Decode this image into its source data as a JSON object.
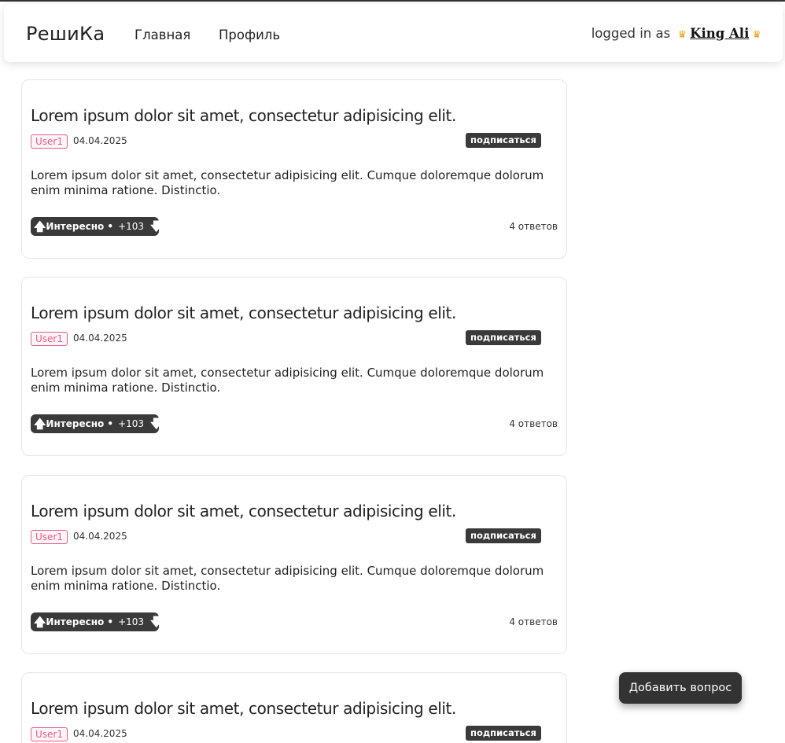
{
  "nav": {
    "brand": "РешиКа",
    "home": "Главная",
    "profile": "Профиль",
    "logged_in_prefix": "logged in as",
    "username": "King Ali",
    "crown_glyph": "♛"
  },
  "questions": [
    {
      "title": "Lorem ipsum dolor sit amet, consectetur adipisicing elit.",
      "user": "User1",
      "date": "04.04.2025",
      "subscribe": "подписаться",
      "body": "Lorem ipsum dolor sit amet, consectetur adipisicing elit. Cumque doloremque dolorum enim minima ratione. Distinctio.",
      "vote_label": "Интересно •",
      "vote_count": "+103",
      "answers": "4 ответов"
    },
    {
      "title": "Lorem ipsum dolor sit amet, consectetur adipisicing elit.",
      "user": "User1",
      "date": "04.04.2025",
      "subscribe": "подписаться",
      "body": "Lorem ipsum dolor sit amet, consectetur adipisicing elit. Cumque doloremque dolorum enim minima ratione. Distinctio.",
      "vote_label": "Интересно •",
      "vote_count": "+103",
      "answers": "4 ответов"
    },
    {
      "title": "Lorem ipsum dolor sit amet, consectetur adipisicing elit.",
      "user": "User1",
      "date": "04.04.2025",
      "subscribe": "подписаться",
      "body": "Lorem ipsum dolor sit amet, consectetur adipisicing elit. Cumque doloremque dolorum enim minima ratione. Distinctio.",
      "vote_label": "Интересно •",
      "vote_count": "+103",
      "answers": "4 ответов"
    },
    {
      "title": "Lorem ipsum dolor sit amet, consectetur adipisicing elit.",
      "user": "User1",
      "date": "04.04.2025",
      "subscribe": "подписаться"
    }
  ],
  "add_question": "Добавить вопрос",
  "icons": {
    "up": "arrow-up-icon",
    "down": "arrow-down-icon",
    "crown": "crown-icon"
  },
  "colors": {
    "dark": "#3a3a3a",
    "user_badge": "#e0608a",
    "crown": "#e6a11b"
  }
}
